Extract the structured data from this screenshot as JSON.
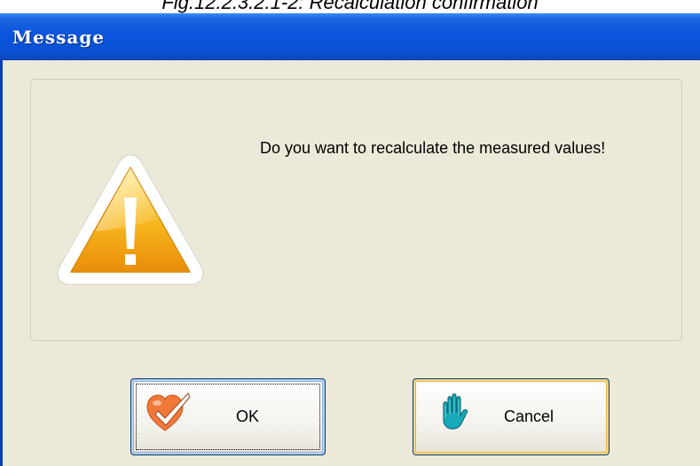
{
  "caption": "Fig.12.2.3.2.1-2: Recalculation confirmation",
  "window": {
    "title": "Message"
  },
  "dialog": {
    "message": "Do you want to recalculate the measured values!",
    "icon": "warning-icon"
  },
  "buttons": {
    "ok_label": "OK",
    "ok_icon": "checkmark-heart-icon",
    "cancel_label": "Cancel",
    "cancel_icon": "hand-icon"
  },
  "colors": {
    "titlebar": "#0a55dd",
    "dialog_bg": "#ece9d8",
    "warning_fill": "#f5b020",
    "cancel_hand": "#18a9b8",
    "ok_icon": "#f07838"
  }
}
